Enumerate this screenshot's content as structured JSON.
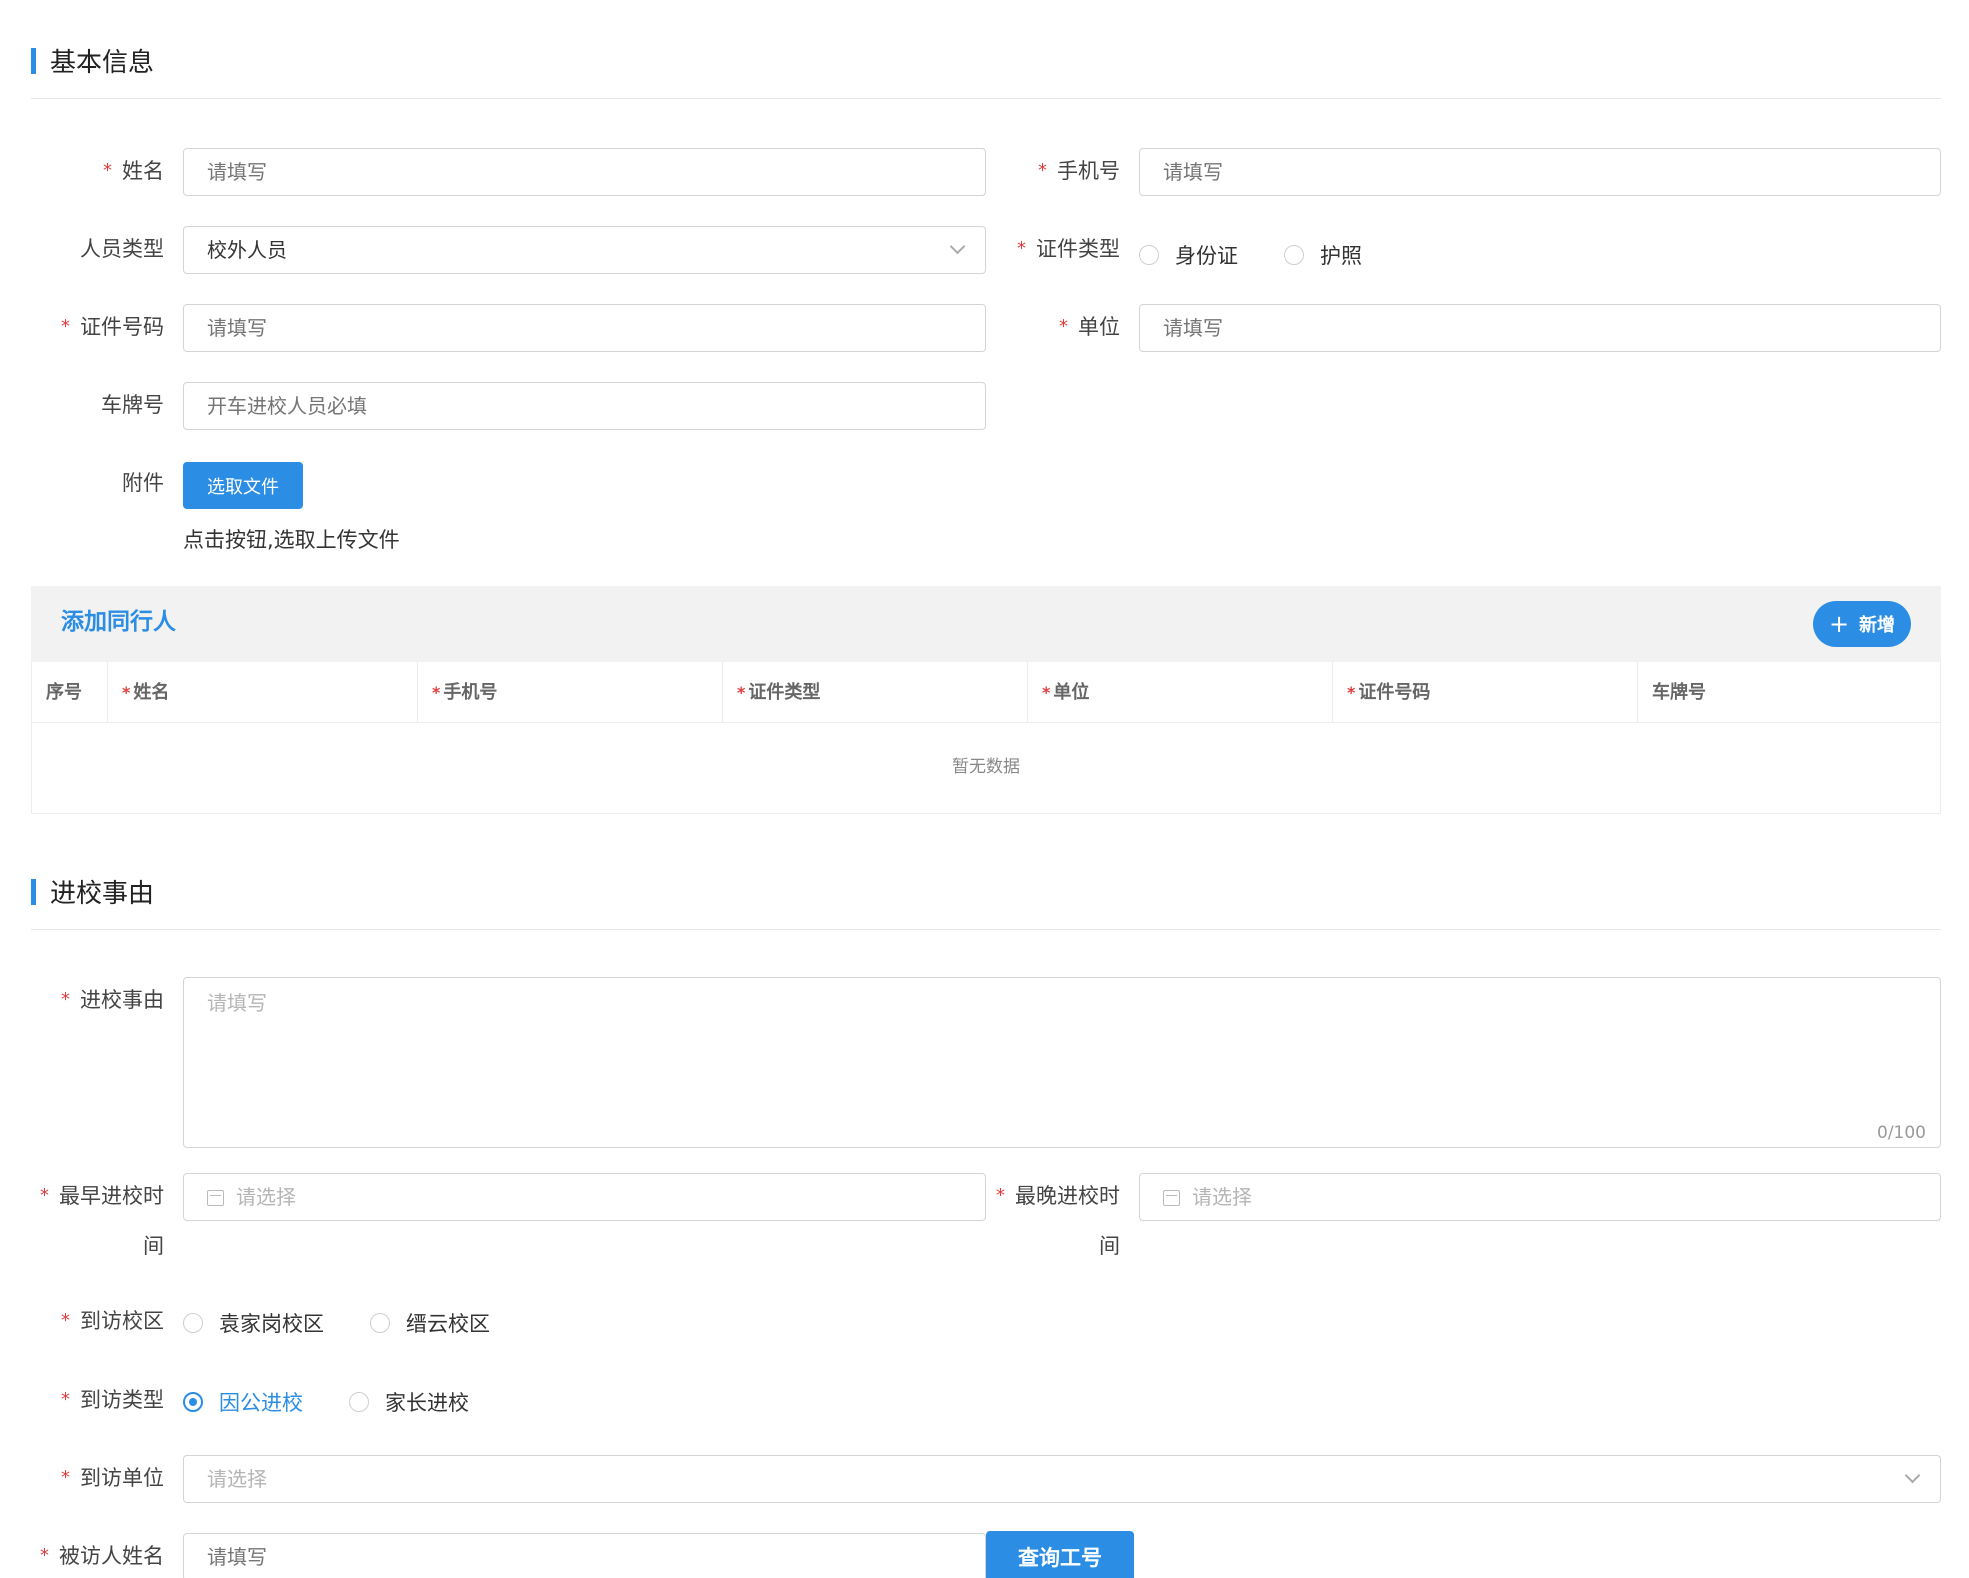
{
  "basic_section": {
    "title": "基本信息"
  },
  "name": {
    "label": "姓名",
    "placeholder": "请填写"
  },
  "phone": {
    "label": "手机号",
    "placeholder": "请填写"
  },
  "person_type": {
    "label": "人员类型",
    "value": "校外人员"
  },
  "id_type": {
    "label": "证件类型",
    "options": [
      "身份证",
      "护照"
    ]
  },
  "id_number": {
    "label": "证件号码",
    "placeholder": "请填写"
  },
  "unit": {
    "label": "单位",
    "placeholder": "请填写"
  },
  "plate": {
    "label": "车牌号",
    "placeholder": "开车进校人员必填"
  },
  "attachment": {
    "label": "附件",
    "button": "选取文件",
    "hint": "点击按钮,选取上传文件"
  },
  "companions": {
    "title": "添加同行人",
    "add_button": "新增",
    "columns": [
      "序号",
      "姓名",
      "手机号",
      "证件类型",
      "单位",
      "证件号码",
      "车牌号"
    ],
    "empty_text": "暂无数据"
  },
  "reason_section": {
    "title": "进校事由"
  },
  "reason": {
    "label": "进校事由",
    "placeholder": "请填写",
    "counter": "0/100"
  },
  "earliest_time": {
    "label_line1": "最早进校时",
    "label_line2": "间",
    "placeholder": "请选择"
  },
  "latest_time": {
    "label_line1": "最晚进校时",
    "label_line2": "间",
    "placeholder": "请选择"
  },
  "campus": {
    "label": "到访校区",
    "options": [
      "袁家岗校区",
      "缙云校区"
    ]
  },
  "visit_type": {
    "label": "到访类型",
    "options": [
      "因公进校",
      "家长进校"
    ],
    "selected": "因公进校"
  },
  "visit_unit": {
    "label": "到访单位",
    "placeholder": "请选择"
  },
  "host_name": {
    "label": "被访人姓名",
    "placeholder": "请填写",
    "button": "查询工号"
  },
  "colors": {
    "accent": "#2b8de3",
    "required": "#e23c3c"
  }
}
